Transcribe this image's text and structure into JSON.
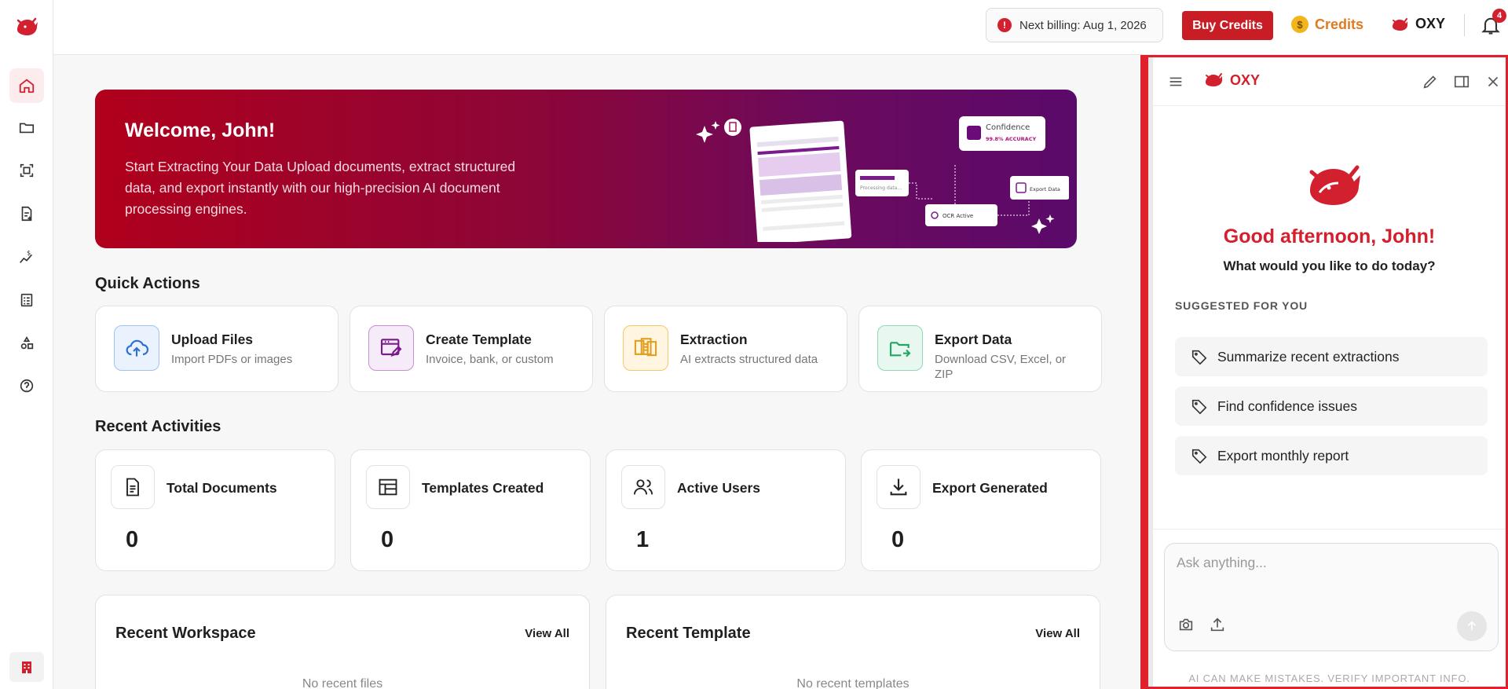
{
  "header": {
    "billing_label": "Next billing: Aug 1, 2026",
    "buy_credits_label": "Buy Credits",
    "credits_label": "Credits",
    "oxy_label": "OXY",
    "notification_count": "4"
  },
  "hero": {
    "title": "Welcome, John!",
    "description": "Start Extracting Your Data Upload documents, extract structured data, and export instantly with our high-precision AI document processing engines.",
    "art": {
      "confidence_label": "Confidence",
      "accuracy_label": "99.8% ACCURACY",
      "processing_label": "Processing data...",
      "export_label": "Export Data",
      "ocr_label": "OCR Active"
    }
  },
  "quick_actions": {
    "title": "Quick Actions",
    "items": [
      {
        "title": "Upload Files",
        "subtitle": "Import PDFs or images",
        "icon": "cloud-upload-icon"
      },
      {
        "title": "Create Template",
        "subtitle": "Invoice, bank, or custom",
        "icon": "template-edit-icon"
      },
      {
        "title": "Extraction",
        "subtitle": "AI extracts structured data",
        "icon": "documents-icon"
      },
      {
        "title": "Export Data",
        "subtitle": "Download CSV, Excel, or ZIP",
        "icon": "folder-export-icon"
      }
    ]
  },
  "recent_activities": {
    "title": "Recent Activities",
    "items": [
      {
        "title": "Total Documents",
        "value": "0",
        "icon": "document-icon"
      },
      {
        "title": "Templates Created",
        "value": "0",
        "icon": "layout-icon"
      },
      {
        "title": "Active Users",
        "value": "1",
        "icon": "users-icon"
      },
      {
        "title": "Export Generated",
        "value": "0",
        "icon": "download-icon"
      }
    ]
  },
  "panels": {
    "workspace": {
      "title": "Recent Workspace",
      "link": "View All",
      "empty": "No recent files"
    },
    "template": {
      "title": "Recent Template",
      "link": "View All",
      "empty": "No recent templates"
    }
  },
  "assistant": {
    "brand": "OXY",
    "greeting": "Good afternoon, John!",
    "prompt": "What would you like to do today?",
    "suggested_title": "SUGGESTED FOR YOU",
    "suggestions": [
      "Summarize recent extractions",
      "Find confidence issues",
      "Export monthly report"
    ],
    "input_placeholder": "Ask anything...",
    "disclaimer": "AI CAN MAKE MISTAKES. VERIFY IMPORTANT INFO."
  },
  "colors": {
    "brand_red": "#c81d25",
    "credits_orange": "#e07a1f",
    "hero_gradient_start": "#b0001c",
    "hero_gradient_end": "#5a0a6a"
  }
}
